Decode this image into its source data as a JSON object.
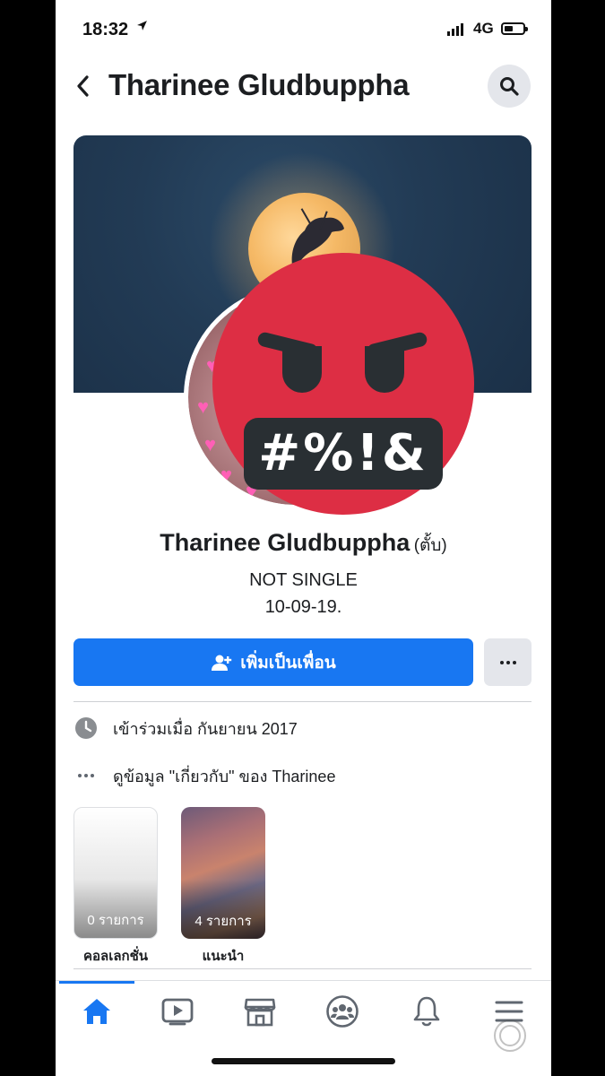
{
  "status_bar": {
    "time": "18:32",
    "location_icon": "location-arrow-icon",
    "network": "4G"
  },
  "header": {
    "back_icon": "chevron-left-icon",
    "title": "Tharinee Gludbuppha",
    "search_icon": "search-icon"
  },
  "profile": {
    "name": "Tharinee Gludbuppha",
    "nickname": "(ตั้บ)",
    "bio_line1": "NOT SINGLE",
    "bio_line2": "10-09-19.",
    "overlay_sticker_text": "#%!&"
  },
  "actions": {
    "add_friend_label": "เพิ่มเป็นเพื่อน",
    "add_friend_icon": "add-person-icon",
    "more_icon": "more-dots-icon"
  },
  "info": {
    "joined": "เข้าร่วมเมื่อ กันยายน  2017",
    "about": "ดูข้อมูล \"เกี่ยวกับ\" ของ Tharinee"
  },
  "highlights": [
    {
      "count": "0 รายการ",
      "label": "คอลเลกชั่น"
    },
    {
      "count": "4 รายการ",
      "label": "แนะนำ"
    }
  ],
  "tabs": [
    {
      "name": "home",
      "icon": "home-icon",
      "active": true
    },
    {
      "name": "watch",
      "icon": "video-icon",
      "active": false
    },
    {
      "name": "marketplace",
      "icon": "store-icon",
      "active": false
    },
    {
      "name": "groups",
      "icon": "groups-icon",
      "active": false
    },
    {
      "name": "notifications",
      "icon": "bell-icon",
      "active": false
    },
    {
      "name": "menu",
      "icon": "menu-icon",
      "active": false
    }
  ],
  "colors": {
    "accent": "#1877f2",
    "emoji_red": "#dd2e44",
    "emoji_dark": "#292f33"
  }
}
